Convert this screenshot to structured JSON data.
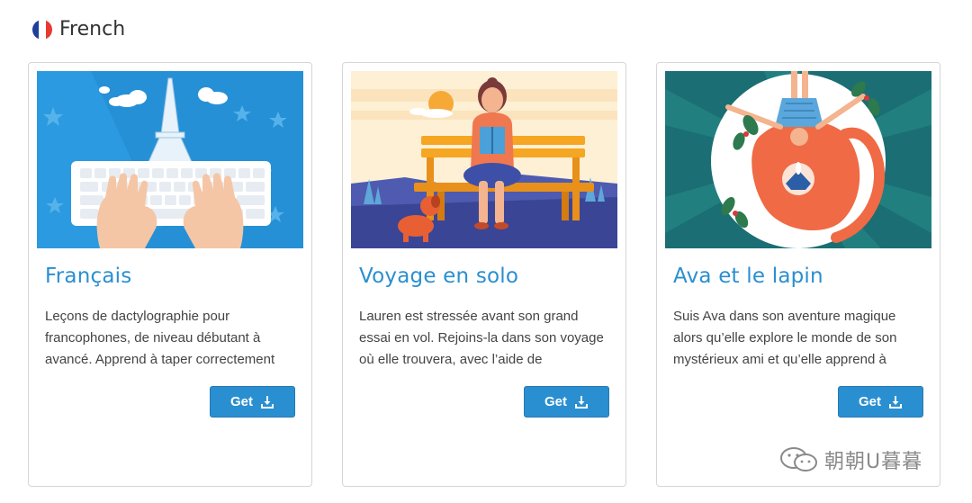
{
  "section": {
    "title": "French",
    "flag_colors": [
      "#1f3f9b",
      "#ffffff",
      "#e63b30"
    ]
  },
  "cards": [
    {
      "title": "Français",
      "description": "Leçons de dactylographie pour francophones, de niveau débutant à avancé. Apprend à taper correctement",
      "button_label": "Get",
      "icon": "download-icon"
    },
    {
      "title": "Voyage en solo",
      "description": "Lauren est stressée avant son grand essai en vol. Rejoins-la dans son voyage où elle trouvera, avec l’aide de",
      "button_label": "Get",
      "icon": "download-icon"
    },
    {
      "title": "Ava et le lapin",
      "description": "Suis Ava dans son aventure magique alors qu’elle explore le monde de son mystérieux ami et qu’elle apprend à",
      "button_label": "Get",
      "icon": "download-icon"
    }
  ],
  "watermark": {
    "text": "朝朝U暮暮",
    "icon": "wechat-icon"
  },
  "colors": {
    "accent": "#2a8fd0",
    "card_border": "#d6d6d6"
  }
}
